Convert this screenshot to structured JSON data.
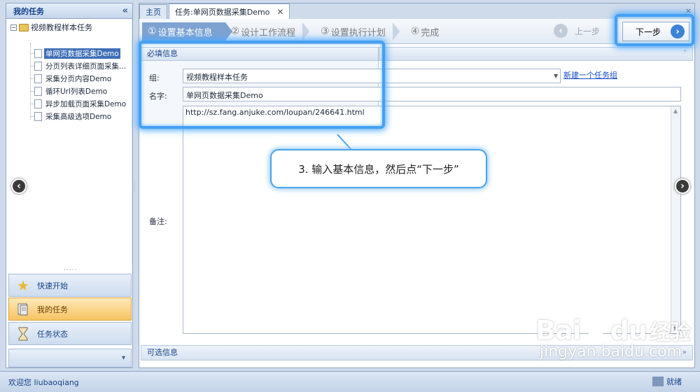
{
  "sidebar": {
    "title": "我的任务",
    "collapse_glyph": "«",
    "tree": {
      "root": "视频教程样本任务",
      "items": [
        {
          "label": "单网页数据采集Demo",
          "selected": true
        },
        {
          "label": "分页列表详细页面采集..."
        },
        {
          "label": "采集分页内容Demo"
        },
        {
          "label": "循环Url列表Demo"
        },
        {
          "label": "异步加载页面采集Demo"
        },
        {
          "label": "采集高级选项Demo"
        }
      ]
    },
    "nav": [
      {
        "label": "快速开始",
        "icon": "star-icon"
      },
      {
        "label": "我的任务",
        "icon": "task-folder-icon",
        "active": true
      },
      {
        "label": "任务状态",
        "icon": "hourglass-icon"
      }
    ],
    "footer_glyph": "▾"
  },
  "tabs": [
    {
      "label": "主页"
    },
    {
      "label": "任务:单网页数据采集Demo",
      "close": "✕",
      "active": true
    }
  ],
  "wizard": {
    "steps": [
      {
        "num": "①",
        "label": "设置基本信息",
        "active": true
      },
      {
        "num": "②",
        "label": "设计工作流程"
      },
      {
        "num": "③",
        "label": "设置执行计划"
      },
      {
        "num": "④",
        "label": "完成"
      }
    ],
    "prev_label": "上一步",
    "next_label": "下一步"
  },
  "form": {
    "required_title": "必填信息",
    "group_label": "组:",
    "group_value": "视频教程样本任务",
    "new_group_link": "新建一个任务组",
    "name_label": "名字:",
    "name_value": "单网页数据采集Demo",
    "url_value": "http://sz.fang.anjuke.com/loupan/246641.html",
    "note_label": "备注:",
    "optional_title": "可选信息"
  },
  "callout": {
    "text": "3. 输入基本信息，然后点“下一步”"
  },
  "status": {
    "welcome": "欢迎您 liubaoqiang",
    "right_label": "就绪"
  },
  "watermark": {
    "logo_text": "Bai",
    "logo_text2": "du",
    "logo_cn": "经验",
    "url": "jingyan.baidu.com"
  },
  "colors": {
    "accent": "#45a0f2",
    "active_step": "#7ea2d2",
    "active_nav": "#f7c463"
  }
}
